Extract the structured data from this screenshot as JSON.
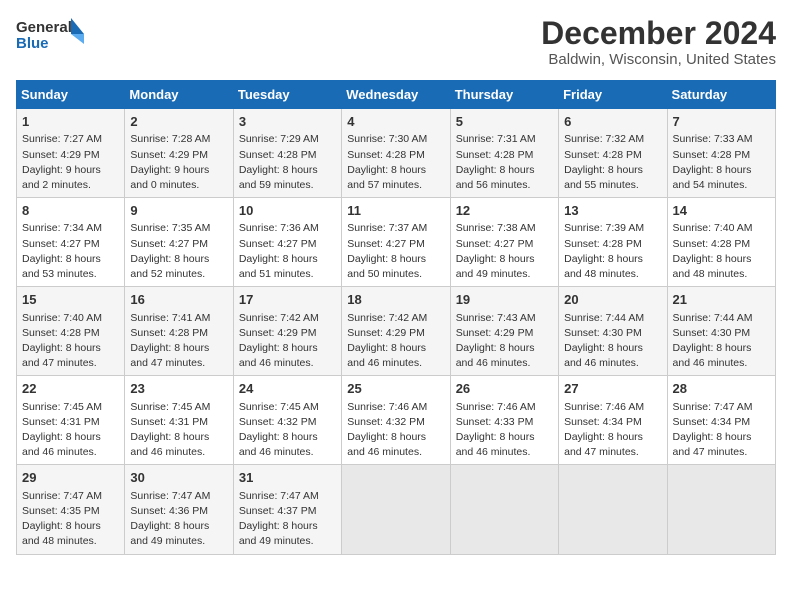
{
  "logo": {
    "line1": "General",
    "line2": "Blue"
  },
  "title": "December 2024",
  "subtitle": "Baldwin, Wisconsin, United States",
  "headers": [
    "Sunday",
    "Monday",
    "Tuesday",
    "Wednesday",
    "Thursday",
    "Friday",
    "Saturday"
  ],
  "weeks": [
    [
      {
        "day": "1",
        "info": "Sunrise: 7:27 AM\nSunset: 4:29 PM\nDaylight: 9 hours\nand 2 minutes."
      },
      {
        "day": "2",
        "info": "Sunrise: 7:28 AM\nSunset: 4:29 PM\nDaylight: 9 hours\nand 0 minutes."
      },
      {
        "day": "3",
        "info": "Sunrise: 7:29 AM\nSunset: 4:28 PM\nDaylight: 8 hours\nand 59 minutes."
      },
      {
        "day": "4",
        "info": "Sunrise: 7:30 AM\nSunset: 4:28 PM\nDaylight: 8 hours\nand 57 minutes."
      },
      {
        "day": "5",
        "info": "Sunrise: 7:31 AM\nSunset: 4:28 PM\nDaylight: 8 hours\nand 56 minutes."
      },
      {
        "day": "6",
        "info": "Sunrise: 7:32 AM\nSunset: 4:28 PM\nDaylight: 8 hours\nand 55 minutes."
      },
      {
        "day": "7",
        "info": "Sunrise: 7:33 AM\nSunset: 4:28 PM\nDaylight: 8 hours\nand 54 minutes."
      }
    ],
    [
      {
        "day": "8",
        "info": "Sunrise: 7:34 AM\nSunset: 4:27 PM\nDaylight: 8 hours\nand 53 minutes."
      },
      {
        "day": "9",
        "info": "Sunrise: 7:35 AM\nSunset: 4:27 PM\nDaylight: 8 hours\nand 52 minutes."
      },
      {
        "day": "10",
        "info": "Sunrise: 7:36 AM\nSunset: 4:27 PM\nDaylight: 8 hours\nand 51 minutes."
      },
      {
        "day": "11",
        "info": "Sunrise: 7:37 AM\nSunset: 4:27 PM\nDaylight: 8 hours\nand 50 minutes."
      },
      {
        "day": "12",
        "info": "Sunrise: 7:38 AM\nSunset: 4:27 PM\nDaylight: 8 hours\nand 49 minutes."
      },
      {
        "day": "13",
        "info": "Sunrise: 7:39 AM\nSunset: 4:28 PM\nDaylight: 8 hours\nand 48 minutes."
      },
      {
        "day": "14",
        "info": "Sunrise: 7:40 AM\nSunset: 4:28 PM\nDaylight: 8 hours\nand 48 minutes."
      }
    ],
    [
      {
        "day": "15",
        "info": "Sunrise: 7:40 AM\nSunset: 4:28 PM\nDaylight: 8 hours\nand 47 minutes."
      },
      {
        "day": "16",
        "info": "Sunrise: 7:41 AM\nSunset: 4:28 PM\nDaylight: 8 hours\nand 47 minutes."
      },
      {
        "day": "17",
        "info": "Sunrise: 7:42 AM\nSunset: 4:29 PM\nDaylight: 8 hours\nand 46 minutes."
      },
      {
        "day": "18",
        "info": "Sunrise: 7:42 AM\nSunset: 4:29 PM\nDaylight: 8 hours\nand 46 minutes."
      },
      {
        "day": "19",
        "info": "Sunrise: 7:43 AM\nSunset: 4:29 PM\nDaylight: 8 hours\nand 46 minutes."
      },
      {
        "day": "20",
        "info": "Sunrise: 7:44 AM\nSunset: 4:30 PM\nDaylight: 8 hours\nand 46 minutes."
      },
      {
        "day": "21",
        "info": "Sunrise: 7:44 AM\nSunset: 4:30 PM\nDaylight: 8 hours\nand 46 minutes."
      }
    ],
    [
      {
        "day": "22",
        "info": "Sunrise: 7:45 AM\nSunset: 4:31 PM\nDaylight: 8 hours\nand 46 minutes."
      },
      {
        "day": "23",
        "info": "Sunrise: 7:45 AM\nSunset: 4:31 PM\nDaylight: 8 hours\nand 46 minutes."
      },
      {
        "day": "24",
        "info": "Sunrise: 7:45 AM\nSunset: 4:32 PM\nDaylight: 8 hours\nand 46 minutes."
      },
      {
        "day": "25",
        "info": "Sunrise: 7:46 AM\nSunset: 4:32 PM\nDaylight: 8 hours\nand 46 minutes."
      },
      {
        "day": "26",
        "info": "Sunrise: 7:46 AM\nSunset: 4:33 PM\nDaylight: 8 hours\nand 46 minutes."
      },
      {
        "day": "27",
        "info": "Sunrise: 7:46 AM\nSunset: 4:34 PM\nDaylight: 8 hours\nand 47 minutes."
      },
      {
        "day": "28",
        "info": "Sunrise: 7:47 AM\nSunset: 4:34 PM\nDaylight: 8 hours\nand 47 minutes."
      }
    ],
    [
      {
        "day": "29",
        "info": "Sunrise: 7:47 AM\nSunset: 4:35 PM\nDaylight: 8 hours\nand 48 minutes."
      },
      {
        "day": "30",
        "info": "Sunrise: 7:47 AM\nSunset: 4:36 PM\nDaylight: 8 hours\nand 49 minutes."
      },
      {
        "day": "31",
        "info": "Sunrise: 7:47 AM\nSunset: 4:37 PM\nDaylight: 8 hours\nand 49 minutes."
      },
      null,
      null,
      null,
      null
    ]
  ]
}
